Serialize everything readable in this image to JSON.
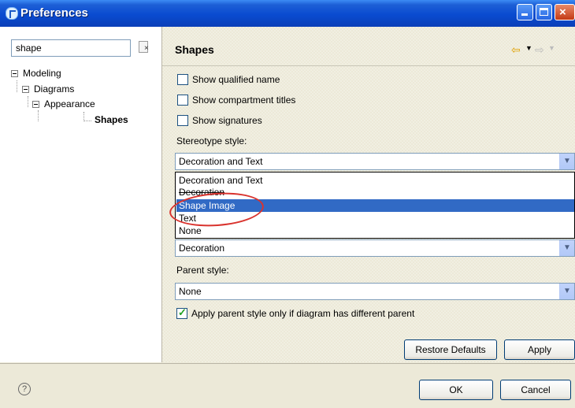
{
  "window": {
    "title": "Preferences"
  },
  "filter": {
    "value": "shape"
  },
  "tree": {
    "items": [
      {
        "label": "Modeling",
        "bold": false
      },
      {
        "label": "Diagrams",
        "bold": false
      },
      {
        "label": "Appearance",
        "bold": false
      },
      {
        "label": "Shapes",
        "bold": true
      }
    ]
  },
  "page": {
    "title": "Shapes",
    "checkboxes": [
      {
        "label": "Show qualified name",
        "checked": false
      },
      {
        "label": "Show compartment titles",
        "checked": false
      },
      {
        "label": "Show signatures",
        "checked": false
      }
    ],
    "stereotype_label": "Stereotype style:",
    "stereotype_value": "Decoration and Text",
    "dropdown_options": [
      "Decoration and Text",
      "Decoration",
      "Shape Image",
      "Text",
      "None"
    ],
    "dropdown_selected": "Shape Image",
    "second_combo_value": "Decoration",
    "parent_label": "Parent style:",
    "parent_value": "None",
    "apply_parent_label": "Apply parent style only if diagram has different parent",
    "apply_parent_checked": true,
    "restore_label": "Restore Defaults",
    "apply_label": "Apply"
  },
  "footer": {
    "ok_label": "OK",
    "cancel_label": "Cancel"
  },
  "colors": {
    "title_bar": "#0a4bd0",
    "selection": "#316ac5",
    "annotation": "#d9332e"
  }
}
